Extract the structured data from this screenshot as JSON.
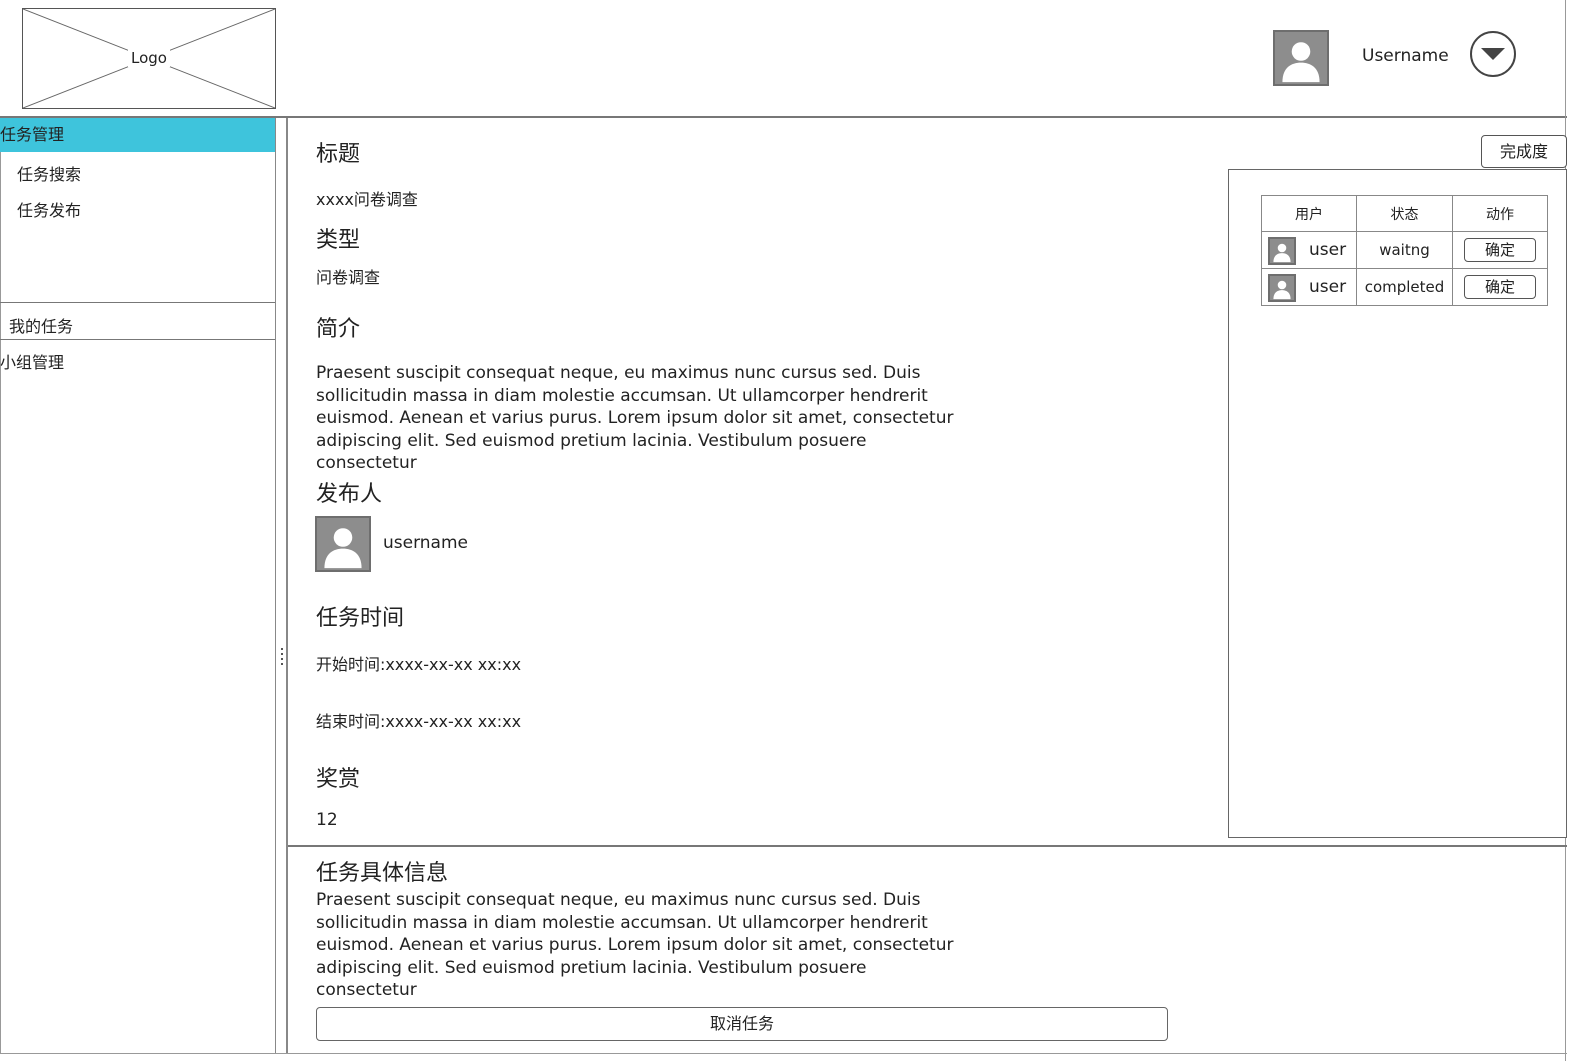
{
  "header": {
    "logo_text": "Logo",
    "username": "Username"
  },
  "sidebar": {
    "task_management": "任务管理",
    "task_search": "任务搜索",
    "task_publish": "任务发布",
    "my_tasks": "我的任务",
    "group_management": "小组管理"
  },
  "task": {
    "title_label": "标题",
    "title_value": "xxxx问卷调查",
    "type_label": "类型",
    "type_value": "问卷调查",
    "intro_label": "简介",
    "intro_text": "Praesent suscipit consequat neque, eu maximus nunc cursus sed. Duis sollicitudin massa in diam molestie accumsan. Ut ullamcorper hendrerit euismod. Aenean et varius purus. Lorem ipsum dolor sit amet, consectetur adipiscing elit. Sed euismod pretium lacinia. Vestibulum posuere consectetur",
    "publisher_label": "发布人",
    "publisher_name": "username",
    "time_label": "任务时间",
    "start_time": "开始时间:xxxx-xx-xx xx:xx",
    "end_time": "结束时间:xxxx-xx-xx xx:xx",
    "reward_label": "奖赏",
    "reward_value": "12",
    "detail_label": "任务具体信息",
    "detail_text": "Praesent suscipit consequat neque, eu maximus nunc cursus sed. Duis sollicitudin massa in diam molestie accumsan. Ut ullamcorper hendrerit euismod. Aenean et varius purus. Lorem ipsum dolor sit amet, consectetur adipiscing elit. Sed euismod pretium lacinia. Vestibulum posuere consectetur",
    "cancel_button": "取消任务"
  },
  "panel": {
    "completion_button": "完成度",
    "columns": [
      "用户",
      "状态",
      "动作"
    ],
    "rows": [
      {
        "user": "user",
        "status": "waitng",
        "action": "确定"
      },
      {
        "user": "user",
        "status": "completed",
        "action": "确定"
      }
    ]
  },
  "colors": {
    "accent": "#3ec4dc",
    "avatar": "#8d8d8d"
  }
}
